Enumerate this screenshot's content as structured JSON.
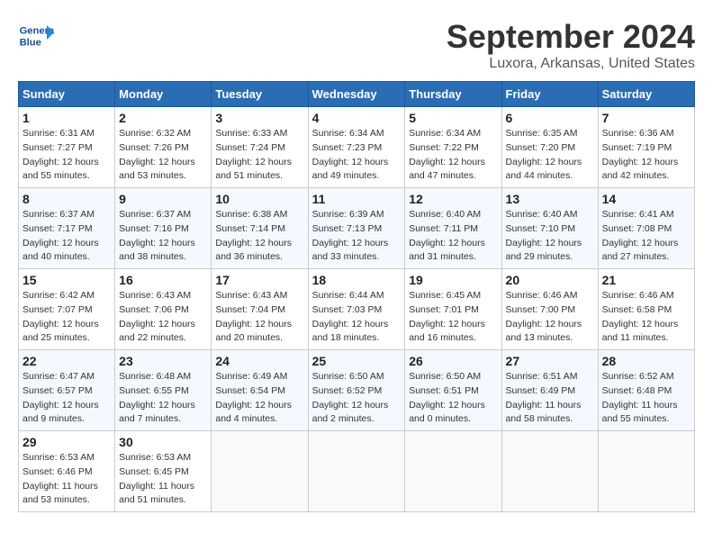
{
  "header": {
    "logo_text_general": "General",
    "logo_text_blue": "Blue",
    "month_title": "September 2024",
    "location": "Luxora, Arkansas, United States"
  },
  "calendar": {
    "days_of_week": [
      "Sunday",
      "Monday",
      "Tuesday",
      "Wednesday",
      "Thursday",
      "Friday",
      "Saturday"
    ],
    "weeks": [
      [
        {
          "day": "1",
          "sunrise": "6:31 AM",
          "sunset": "7:27 PM",
          "daylight": "12 hours and 55 minutes."
        },
        {
          "day": "2",
          "sunrise": "6:32 AM",
          "sunset": "7:26 PM",
          "daylight": "12 hours and 53 minutes."
        },
        {
          "day": "3",
          "sunrise": "6:33 AM",
          "sunset": "7:24 PM",
          "daylight": "12 hours and 51 minutes."
        },
        {
          "day": "4",
          "sunrise": "6:34 AM",
          "sunset": "7:23 PM",
          "daylight": "12 hours and 49 minutes."
        },
        {
          "day": "5",
          "sunrise": "6:34 AM",
          "sunset": "7:22 PM",
          "daylight": "12 hours and 47 minutes."
        },
        {
          "day": "6",
          "sunrise": "6:35 AM",
          "sunset": "7:20 PM",
          "daylight": "12 hours and 44 minutes."
        },
        {
          "day": "7",
          "sunrise": "6:36 AM",
          "sunset": "7:19 PM",
          "daylight": "12 hours and 42 minutes."
        }
      ],
      [
        {
          "day": "8",
          "sunrise": "6:37 AM",
          "sunset": "7:17 PM",
          "daylight": "12 hours and 40 minutes."
        },
        {
          "day": "9",
          "sunrise": "6:37 AM",
          "sunset": "7:16 PM",
          "daylight": "12 hours and 38 minutes."
        },
        {
          "day": "10",
          "sunrise": "6:38 AM",
          "sunset": "7:14 PM",
          "daylight": "12 hours and 36 minutes."
        },
        {
          "day": "11",
          "sunrise": "6:39 AM",
          "sunset": "7:13 PM",
          "daylight": "12 hours and 33 minutes."
        },
        {
          "day": "12",
          "sunrise": "6:40 AM",
          "sunset": "7:11 PM",
          "daylight": "12 hours and 31 minutes."
        },
        {
          "day": "13",
          "sunrise": "6:40 AM",
          "sunset": "7:10 PM",
          "daylight": "12 hours and 29 minutes."
        },
        {
          "day": "14",
          "sunrise": "6:41 AM",
          "sunset": "7:08 PM",
          "daylight": "12 hours and 27 minutes."
        }
      ],
      [
        {
          "day": "15",
          "sunrise": "6:42 AM",
          "sunset": "7:07 PM",
          "daylight": "12 hours and 25 minutes."
        },
        {
          "day": "16",
          "sunrise": "6:43 AM",
          "sunset": "7:06 PM",
          "daylight": "12 hours and 22 minutes."
        },
        {
          "day": "17",
          "sunrise": "6:43 AM",
          "sunset": "7:04 PM",
          "daylight": "12 hours and 20 minutes."
        },
        {
          "day": "18",
          "sunrise": "6:44 AM",
          "sunset": "7:03 PM",
          "daylight": "12 hours and 18 minutes."
        },
        {
          "day": "19",
          "sunrise": "6:45 AM",
          "sunset": "7:01 PM",
          "daylight": "12 hours and 16 minutes."
        },
        {
          "day": "20",
          "sunrise": "6:46 AM",
          "sunset": "7:00 PM",
          "daylight": "12 hours and 13 minutes."
        },
        {
          "day": "21",
          "sunrise": "6:46 AM",
          "sunset": "6:58 PM",
          "daylight": "12 hours and 11 minutes."
        }
      ],
      [
        {
          "day": "22",
          "sunrise": "6:47 AM",
          "sunset": "6:57 PM",
          "daylight": "12 hours and 9 minutes."
        },
        {
          "day": "23",
          "sunrise": "6:48 AM",
          "sunset": "6:55 PM",
          "daylight": "12 hours and 7 minutes."
        },
        {
          "day": "24",
          "sunrise": "6:49 AM",
          "sunset": "6:54 PM",
          "daylight": "12 hours and 4 minutes."
        },
        {
          "day": "25",
          "sunrise": "6:50 AM",
          "sunset": "6:52 PM",
          "daylight": "12 hours and 2 minutes."
        },
        {
          "day": "26",
          "sunrise": "6:50 AM",
          "sunset": "6:51 PM",
          "daylight": "12 hours and 0 minutes."
        },
        {
          "day": "27",
          "sunrise": "6:51 AM",
          "sunset": "6:49 PM",
          "daylight": "11 hours and 58 minutes."
        },
        {
          "day": "28",
          "sunrise": "6:52 AM",
          "sunset": "6:48 PM",
          "daylight": "11 hours and 55 minutes."
        }
      ],
      [
        {
          "day": "29",
          "sunrise": "6:53 AM",
          "sunset": "6:46 PM",
          "daylight": "11 hours and 53 minutes."
        },
        {
          "day": "30",
          "sunrise": "6:53 AM",
          "sunset": "6:45 PM",
          "daylight": "11 hours and 51 minutes."
        },
        null,
        null,
        null,
        null,
        null
      ]
    ]
  }
}
